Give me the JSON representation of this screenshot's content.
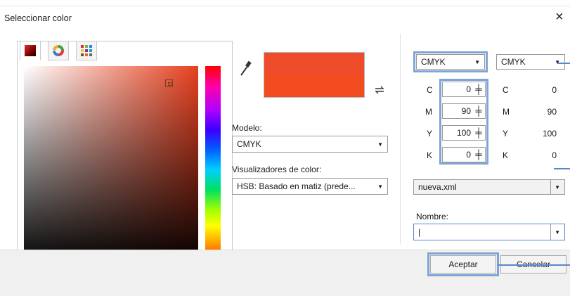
{
  "dialog": {
    "title": "Seleccionar color",
    "close_icon": "×"
  },
  "picker": {
    "tabs": [
      {
        "icon": "color-square-icon"
      },
      {
        "icon": "color-wheel-icon"
      },
      {
        "icon": "color-grid-icon"
      }
    ],
    "color": "#ee4b2b"
  },
  "model": {
    "label": "Modelo:",
    "value": "CMYK"
  },
  "viewers": {
    "label": "Visualizadores de color:",
    "value": "HSB: Basado en matiz (prede..."
  },
  "right": {
    "left_select": "CMYK",
    "right_select": "CMYK",
    "values": [
      {
        "name": "C",
        "input": "0",
        "ref": "0"
      },
      {
        "name": "M",
        "input": "90",
        "ref": "90"
      },
      {
        "name": "Y",
        "input": "100",
        "ref": "100"
      },
      {
        "name": "K",
        "input": "0",
        "ref": "0"
      }
    ],
    "palette": "nueva.xml",
    "name_label": "Nombre:",
    "name_value": "|"
  },
  "buttons": {
    "ok": "Aceptar",
    "cancel": "Cancelar"
  },
  "colors": {
    "highlight": "#7fa5d6",
    "selected": "#ee4b2b"
  }
}
